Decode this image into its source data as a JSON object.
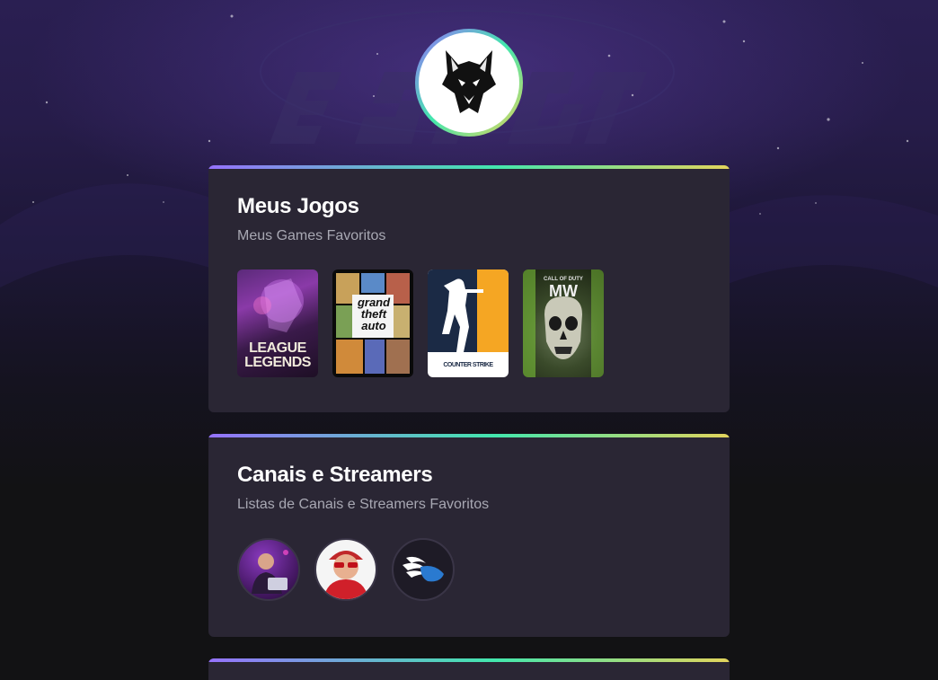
{
  "profile": {
    "avatar_icon": "wolf-icon"
  },
  "games_section": {
    "title": "Meus Jogos",
    "subtitle": "Meus Games Favoritos",
    "games": [
      {
        "name": "League of Legends",
        "logo_line1": "LEAGUE",
        "logo_line2": "LEGENDS"
      },
      {
        "name": "Grand Theft Auto V",
        "logo_line1": "grand",
        "logo_line2": "theft",
        "logo_line3": "auto"
      },
      {
        "name": "Counter-Strike",
        "logo_text": "COUNTER STRIKE"
      },
      {
        "name": "Call of Duty Modern Warfare II",
        "logo_line1": "CALL OF DUTY",
        "logo_line2": "MW"
      }
    ]
  },
  "streams_section": {
    "title": "Canais e Streamers",
    "subtitle": "Listas de Canais e Streamers Favoritos",
    "streamers": [
      {
        "avatar_icon": "streamer-dj-avatar"
      },
      {
        "avatar_icon": "streamer-sunglasses-avatar"
      },
      {
        "avatar_icon": "winged-logo-avatar"
      }
    ]
  },
  "colors": {
    "accent_start": "#9572fc",
    "accent_mid": "#43e7ad",
    "accent_end": "#e2d45c",
    "card_bg": "#2a2634",
    "page_bg": "#121214"
  }
}
